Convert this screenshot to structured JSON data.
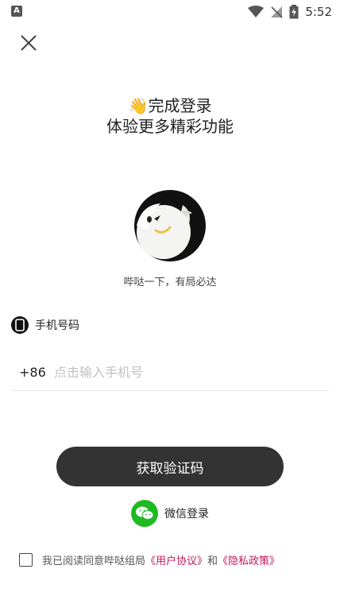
{
  "status_bar": {
    "time": "5:52",
    "left_icon_letter": "A"
  },
  "headline": {
    "emoji": "👋",
    "line1": "完成登录",
    "line2": "体验更多精彩功能"
  },
  "tagline": "哔哒一下，有局必达",
  "phone": {
    "label": "手机号码",
    "country_code": "+86",
    "placeholder": "点击输入手机号",
    "value": ""
  },
  "buttons": {
    "get_code": "获取验证码"
  },
  "wechat": {
    "label": "微信登录"
  },
  "agreement": {
    "prefix": "我已阅读同意哔哒组局",
    "user_agreement": "《用户协议》",
    "conj": "和",
    "privacy_policy": "《隐私政策》"
  },
  "colors": {
    "primary_button": "#333333",
    "wechat_green": "#1fb922",
    "link": "#c2185b"
  }
}
